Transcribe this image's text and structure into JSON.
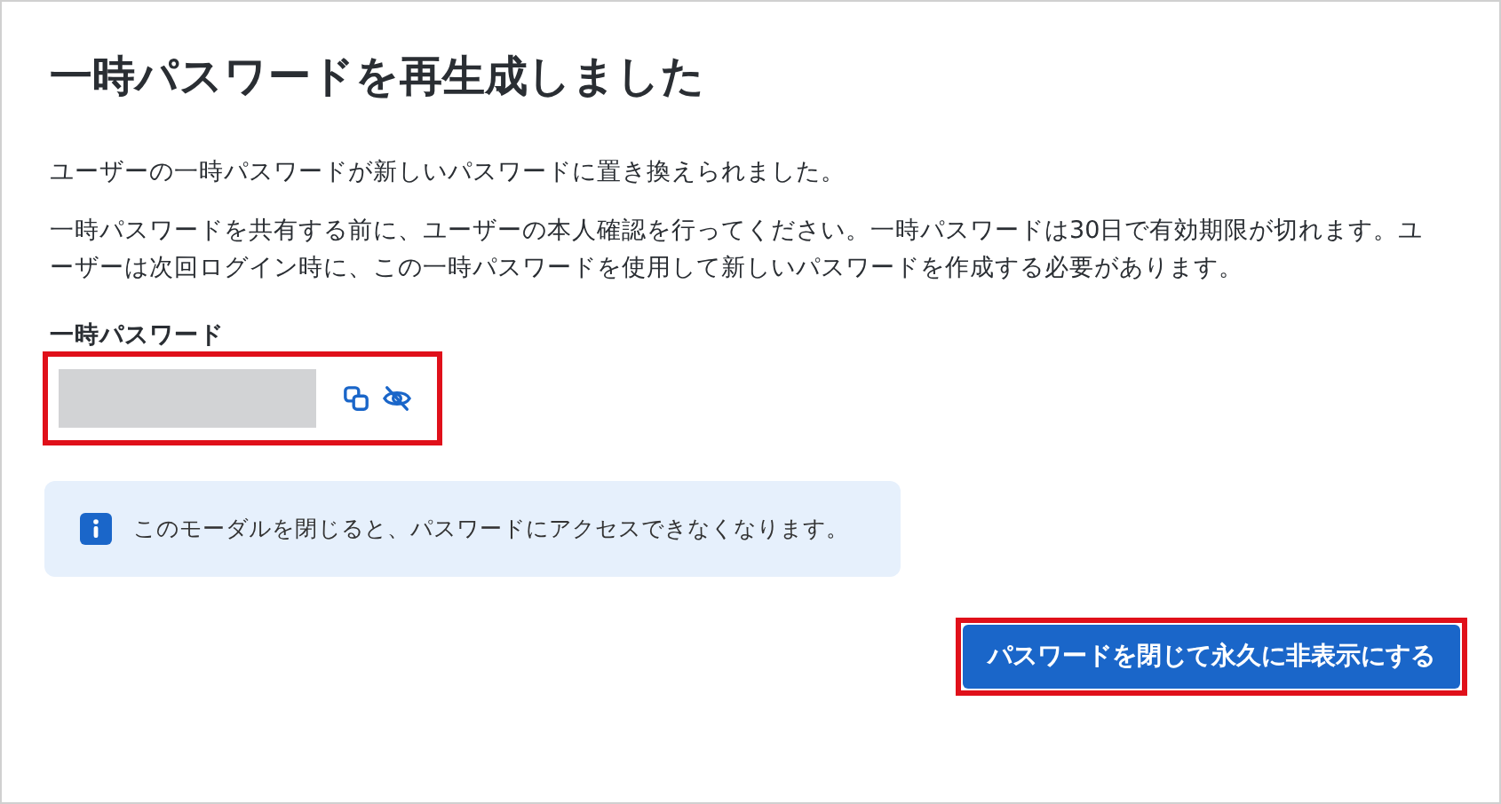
{
  "dialog": {
    "title": "一時パスワードを再生成しました",
    "paragraphs": [
      "ユーザーの一時パスワードが新しいパスワードに置き換えられました。",
      "一時パスワードを共有する前に、ユーザーの本人確認を行ってください。一時パスワードは30日で有効期限が切れます。ユーザーは次回ログイン時に、この一時パスワードを使用して新しいパスワードを作成する必要があります。"
    ],
    "password_field": {
      "label": "一時パスワード",
      "highlighted": true
    },
    "notice": {
      "kind": "info",
      "text": "このモーダルを閉じると、パスワードにアクセスできなくなります。"
    },
    "button": {
      "label": "パスワードを閉じて永久に非表示にする",
      "highlighted": true
    }
  }
}
